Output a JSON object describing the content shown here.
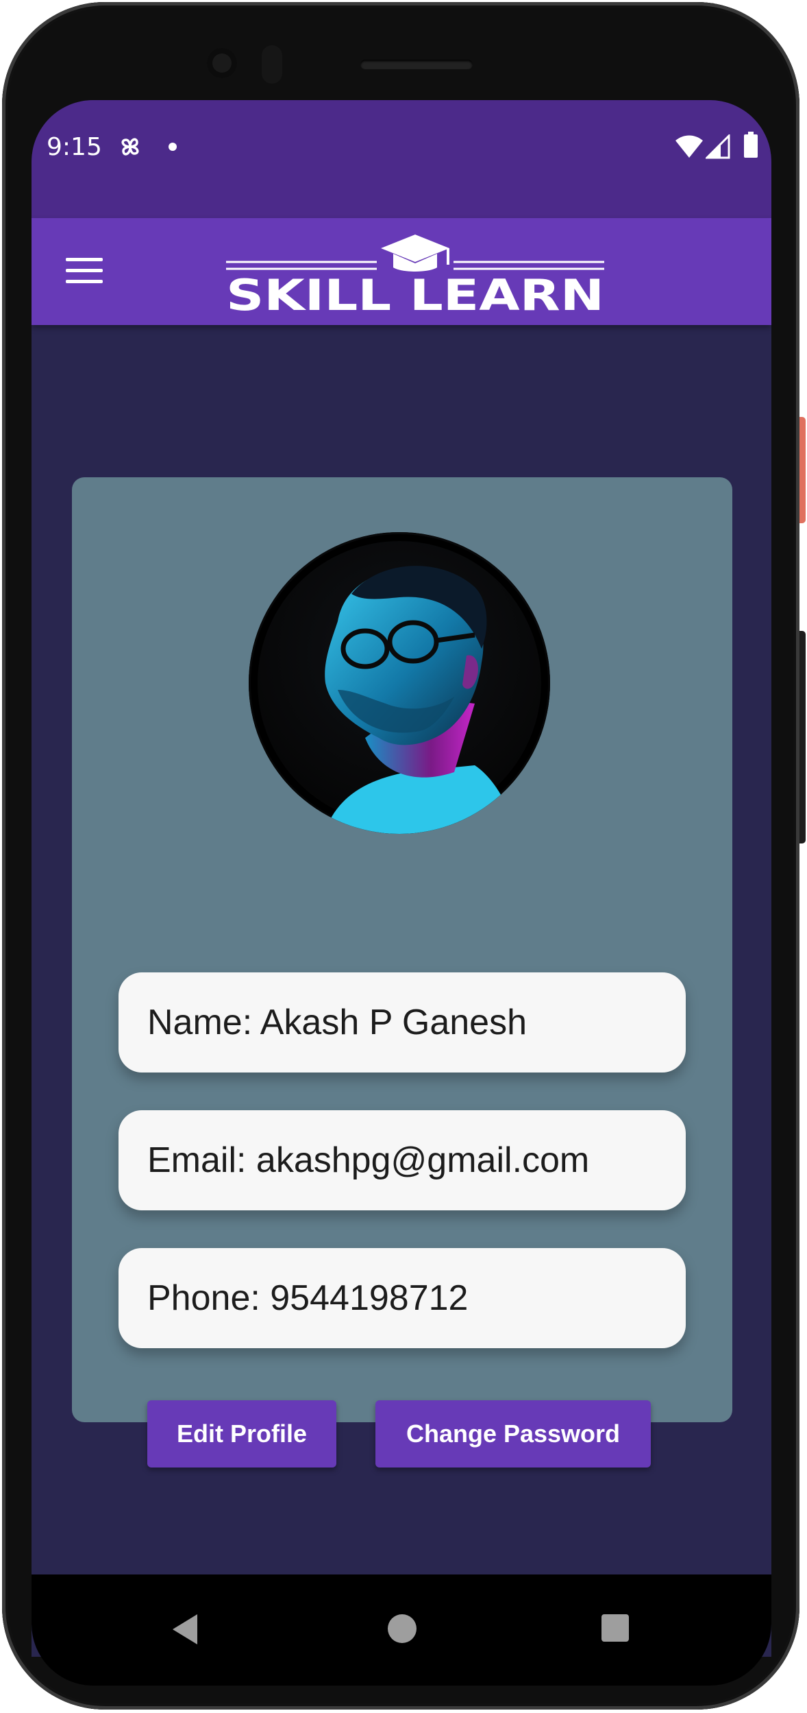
{
  "status_bar": {
    "time": "9:15",
    "icons": [
      "fan-icon",
      "dot-icon",
      "wifi-icon",
      "signal-icon",
      "battery-icon"
    ]
  },
  "app_bar": {
    "menu_icon": "hamburger-menu-icon",
    "logo_text": "SKILL LEARN",
    "logo_icon": "graduation-cap-icon",
    "background_color": "#673ab7"
  },
  "profile": {
    "avatar_alt": "profile photo",
    "name_label": "Name: Akash P Ganesh",
    "email_label": "Email: akashpg@gmail.com",
    "phone_label": "Phone: 9544198712"
  },
  "buttons": {
    "edit_profile": "Edit Profile",
    "change_password": "Change Password"
  },
  "nav_bar": {
    "icons": [
      "back-icon",
      "home-icon",
      "recent-apps-icon"
    ]
  },
  "colors": {
    "status_bar": "#4c2a8a",
    "screen_background": "#29264f",
    "card": "#607d8b",
    "accent": "#673ab7"
  }
}
